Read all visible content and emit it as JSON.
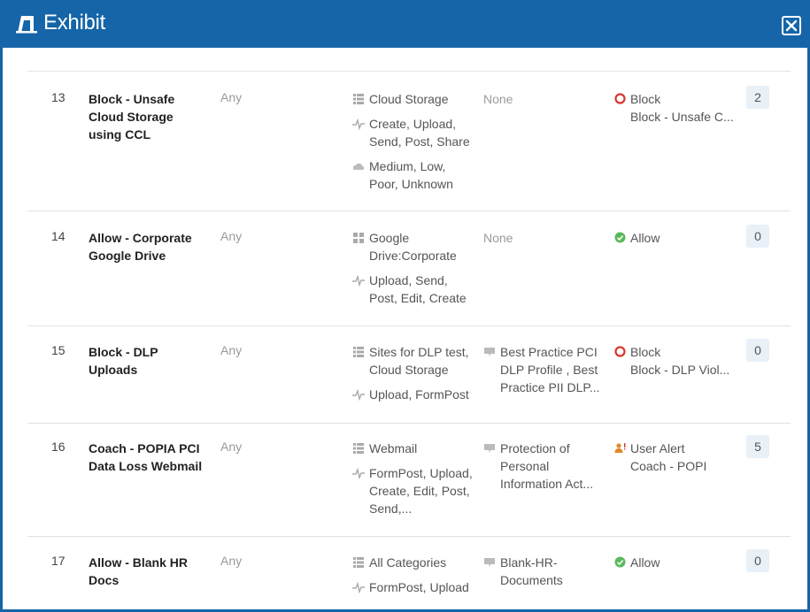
{
  "window": {
    "title": "Exhibit",
    "logo_icon": "exhibit-logo-icon",
    "close_icon": "close-icon",
    "accent": "#1565a8"
  },
  "rules": [
    {
      "number": "13",
      "name": "Block - Unsafe Cloud Storage using CCL",
      "source": "Any",
      "destination": [
        {
          "icon": "category-list-icon",
          "text": "Cloud Storage"
        },
        {
          "icon": "activity-icon",
          "text": "Create, Upload, Send, Post, Share"
        },
        {
          "icon": "cloud-icon",
          "text": "Medium, Low, Poor, Unknown"
        }
      ],
      "profile": {
        "icon": "",
        "text": "None"
      },
      "action": {
        "icon": "block-icon",
        "label": "Block",
        "detail": "Block - Unsafe C..."
      },
      "count": "2"
    },
    {
      "number": "14",
      "name": "Allow - Corporate Google Drive",
      "source": "Any",
      "destination": [
        {
          "icon": "app-grid-icon",
          "text": "Google Drive:Corporate"
        },
        {
          "icon": "activity-icon",
          "text": "Upload, Send, Post, Edit, Create"
        }
      ],
      "profile": {
        "icon": "",
        "text": "None"
      },
      "action": {
        "icon": "allow-check-icon",
        "label": "Allow",
        "detail": ""
      },
      "count": "0"
    },
    {
      "number": "15",
      "name": "Block - DLP Uploads",
      "source": "Any",
      "destination": [
        {
          "icon": "category-list-icon",
          "text": "Sites for DLP test, Cloud Storage"
        },
        {
          "icon": "activity-icon",
          "text": "Upload, FormPost"
        }
      ],
      "profile": {
        "icon": "dlp-profile-icon",
        "text": "Best Practice PCI DLP Profile , Best Practice PII DLP..."
      },
      "action": {
        "icon": "block-icon",
        "label": "Block",
        "detail": "Block - DLP Viol..."
      },
      "count": "0"
    },
    {
      "number": "16",
      "name": "Coach - POPIA PCI Data Loss Webmail",
      "source": "Any",
      "destination": [
        {
          "icon": "category-list-icon",
          "text": "Webmail"
        },
        {
          "icon": "activity-icon",
          "text": "FormPost, Upload, Create, Edit, Post, Send,..."
        }
      ],
      "profile": {
        "icon": "dlp-profile-icon",
        "text": "Protection of Personal Information Act..."
      },
      "action": {
        "icon": "user-alert-icon",
        "label": "User Alert",
        "detail": "Coach - POPI"
      },
      "count": "5"
    },
    {
      "number": "17",
      "name": "Allow - Blank HR Docs",
      "source": "Any",
      "destination": [
        {
          "icon": "category-list-icon",
          "text": "All Categories"
        },
        {
          "icon": "activity-icon",
          "text": "FormPost, Upload"
        }
      ],
      "profile": {
        "icon": "dlp-profile-icon",
        "text": "Blank-HR-Documents"
      },
      "action": {
        "icon": "allow-check-icon",
        "label": "Allow",
        "detail": ""
      },
      "count": "0"
    }
  ]
}
